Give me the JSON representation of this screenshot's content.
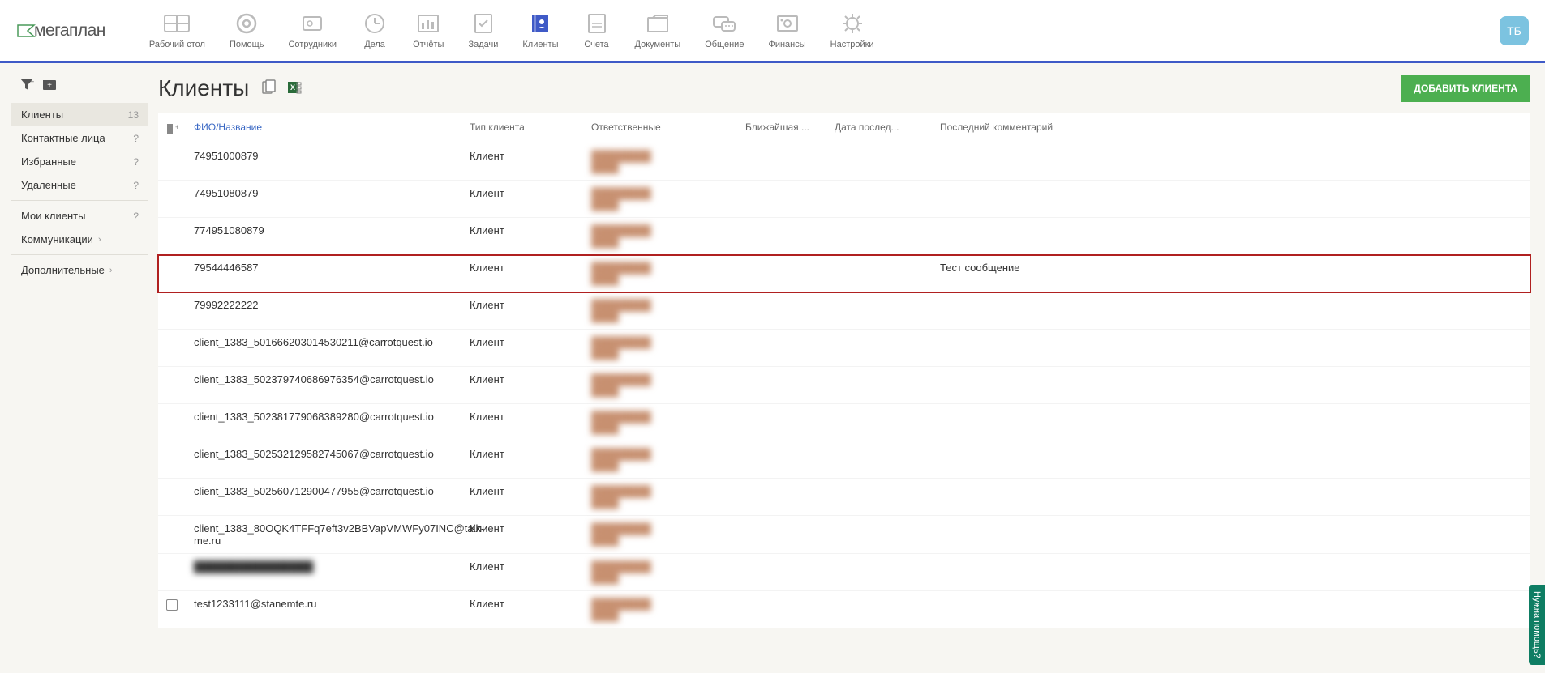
{
  "user_badge": "ТБ",
  "logo": "мегаплан",
  "nav": [
    {
      "label": "Рабочий стол"
    },
    {
      "label": "Помощь"
    },
    {
      "label": "Сотрудники"
    },
    {
      "label": "Дела"
    },
    {
      "label": "Отчёты"
    },
    {
      "label": "Задачи"
    },
    {
      "label": "Клиенты",
      "active": true
    },
    {
      "label": "Счета"
    },
    {
      "label": "Документы"
    },
    {
      "label": "Общение"
    },
    {
      "label": "Финансы"
    },
    {
      "label": "Настройки"
    }
  ],
  "sidebar": {
    "groups": [
      [
        {
          "label": "Клиенты",
          "count": "13",
          "active": true
        },
        {
          "label": "Контактные лица",
          "count": "?"
        },
        {
          "label": "Избранные",
          "count": "?"
        },
        {
          "label": "Удаленные",
          "count": "?"
        }
      ],
      [
        {
          "label": "Мои клиенты",
          "count": "?"
        },
        {
          "label": "Коммуникации",
          "chev": true
        }
      ],
      [
        {
          "label": "Дополнительные",
          "chev": true
        }
      ]
    ]
  },
  "page": {
    "title": "Клиенты",
    "add_button": "ДОБАВИТЬ КЛИЕНТА"
  },
  "columns": {
    "name": "ФИО/Название",
    "type": "Тип клиента",
    "resp": "Ответственные",
    "near": "Ближайшая ...",
    "date": "Дата послед...",
    "comment": "Последний комментарий"
  },
  "rows": [
    {
      "name": "74951000879",
      "type": "Клиент",
      "resp1": "████████",
      "resp2": "████",
      "comment": ""
    },
    {
      "name": "74951080879",
      "type": "Клиент",
      "resp1": "████████",
      "resp2": "████",
      "comment": ""
    },
    {
      "name": "774951080879",
      "type": "Клиент",
      "resp1": "████████",
      "resp2": "████",
      "comment": ""
    },
    {
      "name": "79544446587",
      "type": "Клиент",
      "resp1": "████████",
      "resp2": "████",
      "comment": "Тест сообщение",
      "highlight": true
    },
    {
      "name": "79992222222",
      "type": "Клиент",
      "resp1": "████████",
      "resp2": "████",
      "comment": ""
    },
    {
      "name": "client_1383_501666203014530211@carrotquest.io",
      "type": "Клиент",
      "resp1": "████████",
      "resp2": "████",
      "comment": ""
    },
    {
      "name": "client_1383_502379740686976354@carrotquest.io",
      "type": "Клиент",
      "resp1": "████████",
      "resp2": "████",
      "comment": ""
    },
    {
      "name": "client_1383_502381779068389280@carrotquest.io",
      "type": "Клиент",
      "resp1": "████████",
      "resp2": "████",
      "comment": ""
    },
    {
      "name": "client_1383_502532129582745067@carrotquest.io",
      "type": "Клиент",
      "resp1": "████████",
      "resp2": "████",
      "comment": ""
    },
    {
      "name": "client_1383_502560712900477955@carrotquest.io",
      "type": "Клиент",
      "resp1": "████████",
      "resp2": "████",
      "comment": ""
    },
    {
      "name": "client_1383_80OQK4TFFq7eft3v2BBVapVMWFy07INC@talk-me.ru",
      "type": "Клиент",
      "resp1": "████████",
      "resp2": "████",
      "comment": ""
    },
    {
      "name": "████████████████",
      "type": "Клиент",
      "resp1": "████████",
      "resp2": "████",
      "comment": "",
      "blur_name": true
    },
    {
      "name": "test1233111@stanemte.ru",
      "type": "Клиент",
      "resp1": "████████",
      "resp2": "████",
      "comment": "",
      "show_check": true
    }
  ],
  "help_tab": "Нужна помощь?"
}
